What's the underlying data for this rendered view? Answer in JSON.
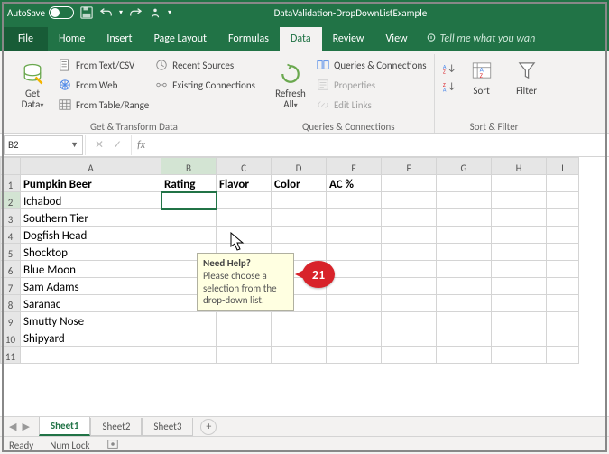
{
  "titlebar": {
    "autosave": "AutoSave",
    "filename": "DataValidation-DropDownListExample"
  },
  "tabs": {
    "file": "File",
    "home": "Home",
    "insert": "Insert",
    "page_layout": "Page Layout",
    "formulas": "Formulas",
    "data": "Data",
    "review": "Review",
    "view": "View",
    "tell_me": "Tell me what you wan"
  },
  "ribbon": {
    "get_data": {
      "label": "Get\nData",
      "text_csv": "From Text/CSV",
      "web": "From Web",
      "table": "From Table/Range",
      "recent": "Recent Sources",
      "existing": "Existing Connections",
      "group": "Get & Transform Data"
    },
    "refresh": {
      "label": "Refresh\nAll",
      "queries": "Queries & Connections",
      "properties": "Properties",
      "edit_links": "Edit Links",
      "group": "Queries & Connections"
    },
    "sort": {
      "sort": "Sort",
      "filter": "Filter",
      "group": "Sort & Filter"
    }
  },
  "formula_bar": {
    "cell_ref": "B2"
  },
  "columns": [
    "A",
    "B",
    "C",
    "D",
    "E",
    "F",
    "G",
    "H",
    "I"
  ],
  "headers": {
    "a": "Pumpkin Beer",
    "b": "Rating",
    "c": "Flavor",
    "d": "Color",
    "e": "AC %"
  },
  "rows": [
    "Ichabod",
    "Southern Tier",
    "Dogfish Head",
    "Shocktop",
    "Blue Moon",
    "Sam Adams",
    "Saranac",
    "Smutty Nose",
    "Shipyard"
  ],
  "tooltip": {
    "title": "Need Help?",
    "body": "Please choose a selection from the drop-down list."
  },
  "callout": {
    "num": "21"
  },
  "sheets": [
    "Sheet1",
    "Sheet2",
    "Sheet3"
  ],
  "status": {
    "ready": "Ready",
    "numlock": "Num Lock"
  }
}
